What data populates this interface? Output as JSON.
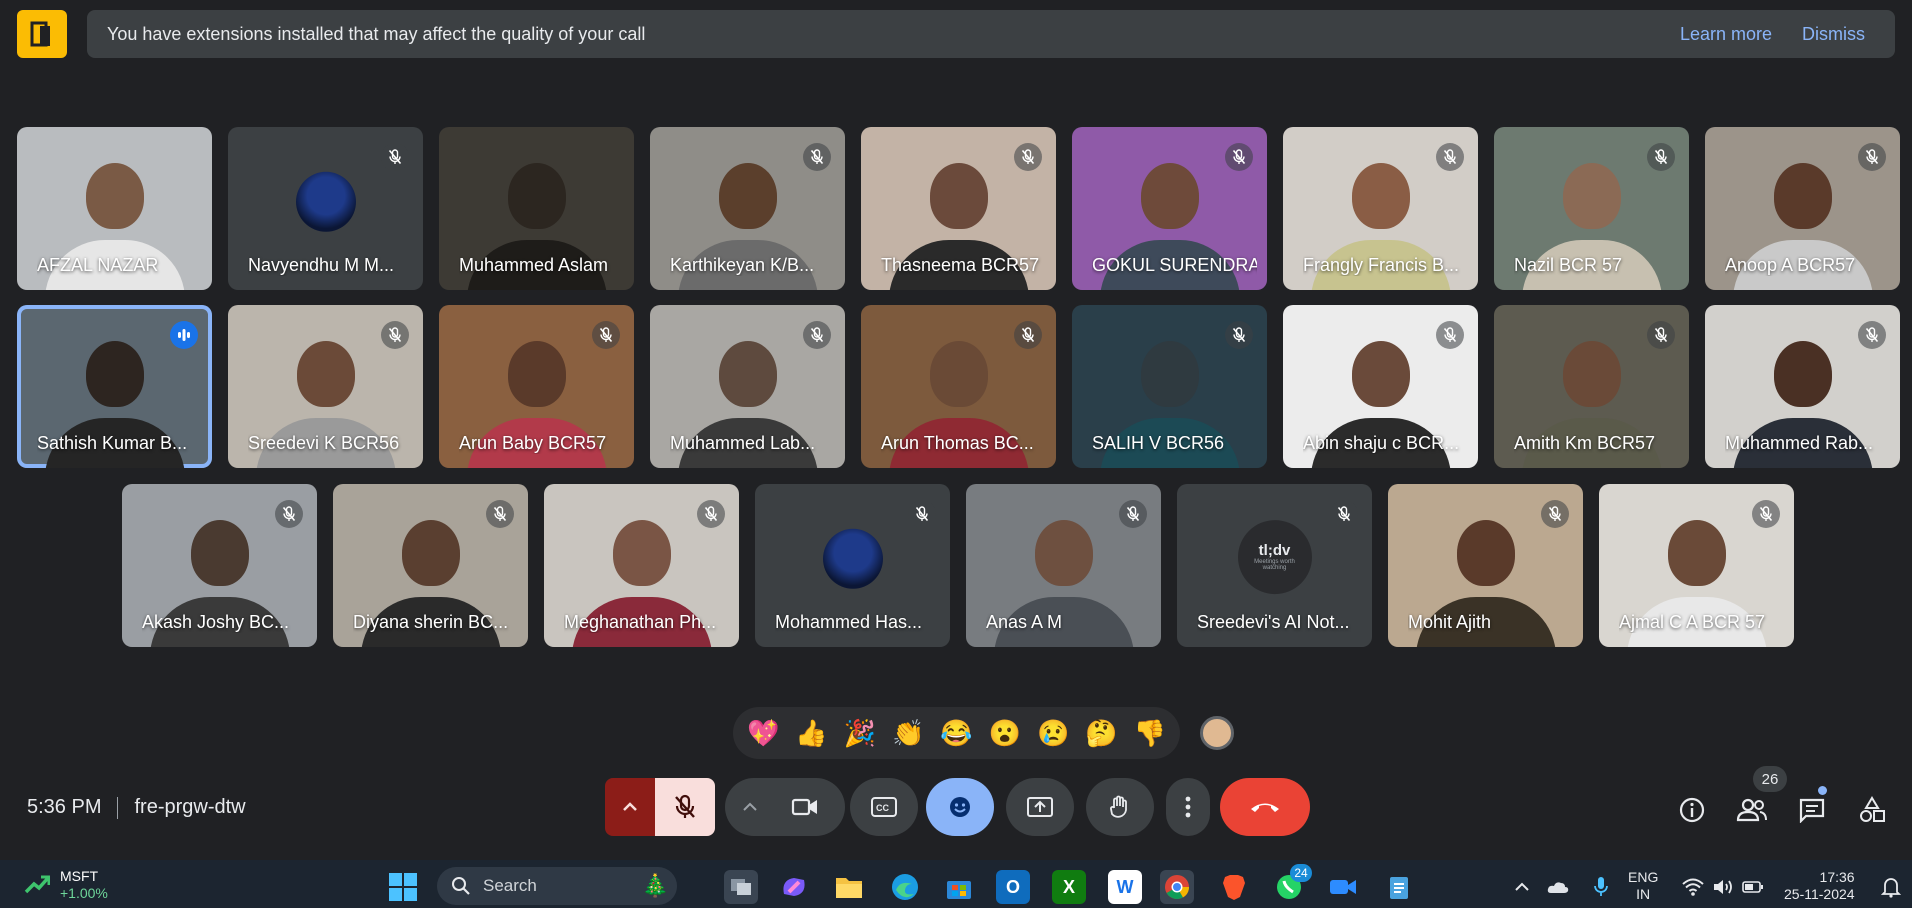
{
  "banner": {
    "message": "You have extensions installed that may affect the quality of your call",
    "learn_more": "Learn more",
    "dismiss": "Dismiss"
  },
  "participants": [
    {
      "name": "AFZAL NAZAR",
      "bg": "#b9bcbf",
      "skin": "#7a5a45",
      "shirt": "#e6e6e6",
      "muted": false
    },
    {
      "name": "Navyendhu M M...",
      "avatar": true,
      "muted": true
    },
    {
      "name": "Muhammed Aslam",
      "bg": "#3d3a34",
      "skin": "#2c2620",
      "shirt": "#1e1c19",
      "muted": false
    },
    {
      "name": "Karthikeyan K/B...",
      "bg": "#8f8d88",
      "skin": "#5b3f2c",
      "shirt": "#6b6b6b",
      "muted": true
    },
    {
      "name": "Thasneema BCR57",
      "bg": "#c3b3a6",
      "skin": "#6b4a3b",
      "shirt": "#2a2a2a",
      "muted": true
    },
    {
      "name": "GOKUL SURENDRAN ...",
      "bg": "#8f5aa8",
      "skin": "#6e4a3a",
      "shirt": "#3e4a5a",
      "muted": true
    },
    {
      "name": "Frangly Francis B...",
      "bg": "#d2cdc7",
      "skin": "#8a5d45",
      "shirt": "#c7c38f",
      "muted": true
    },
    {
      "name": "Nazil BCR 57",
      "bg": "#6d7a70",
      "skin": "#8b6a55",
      "shirt": "#c7c0b0",
      "muted": true
    },
    {
      "name": "Anoop A BCR57",
      "bg": "#9c948a",
      "skin": "#5a3a2a",
      "shirt": "#c9c9c9",
      "muted": true
    },
    {
      "name": "Sathish Kumar B...",
      "bg": "#5b6770",
      "skin": "#2d2520",
      "shirt": "#252525",
      "muted": false,
      "speaking": true,
      "active": true
    },
    {
      "name": "Sreedevi K BCR56",
      "bg": "#bbb5ac",
      "skin": "#6b4a38",
      "shirt": "#9a9a9a",
      "muted": true
    },
    {
      "name": "Arun Baby BCR57",
      "bg": "#8a6040",
      "skin": "#5a3a2a",
      "shirt": "#b23a4a",
      "muted": true
    },
    {
      "name": "Muhammed Lab...",
      "bg": "#a9a7a3",
      "skin": "#5e4a3e",
      "shirt": "#3a3a3a",
      "muted": true
    },
    {
      "name": "Arun Thomas BC...",
      "bg": "#7d5a3d",
      "skin": "#6a4a36",
      "shirt": "#8f2a33",
      "muted": true
    },
    {
      "name": "SALIH V BCR56",
      "bg": "#2a3f4a",
      "skin": "#2f3a40",
      "shirt": "#1c4a55",
      "muted": true
    },
    {
      "name": "Abin shaju c BCR...",
      "bg": "#ececec",
      "skin": "#6a4a3a",
      "shirt": "#2b2b2b",
      "muted": true
    },
    {
      "name": "Amith Km BCR57",
      "bg": "#5d5b50",
      "skin": "#6a4a38",
      "shirt": "#5a5a4a",
      "muted": true
    },
    {
      "name": "Muhammed Rab...",
      "bg": "#d2d0cc",
      "skin": "#4a3024",
      "shirt": "#2a2f38",
      "muted": true
    },
    {
      "name": "Akash Joshy BC...",
      "bg": "#9a9ea3",
      "skin": "#4a3a30",
      "shirt": "#3a3a3a",
      "muted": true
    },
    {
      "name": "Diyana sherin BC...",
      "bg": "#a9a399",
      "skin": "#5a3f30",
      "shirt": "#2a2a2a",
      "muted": true
    },
    {
      "name": "Meghanathan Ph...",
      "bg": "#c9c5bf",
      "skin": "#7a5545",
      "shirt": "#8a2a3a",
      "muted": true
    },
    {
      "name": "Mohammed Has...",
      "avatar": true,
      "muted": true
    },
    {
      "name": "Anas A M",
      "bg": "#787c80",
      "skin": "#6e5040",
      "shirt": "#4a4f55",
      "muted": true
    },
    {
      "name": "Sreedevi's AI Not...",
      "ai": true,
      "ai_title": "tl;dv",
      "ai_sub": "Meetings worth watching",
      "muted": true
    },
    {
      "name": "Mohit Ajith",
      "bg": "#bba890",
      "skin": "#5a3a2a",
      "shirt": "#3a3226",
      "muted": true
    },
    {
      "name": "Ajmal C A BCR 57",
      "bg": "#d9d6d0",
      "skin": "#6a4a38",
      "shirt": "#e8e8e8",
      "muted": true
    }
  ],
  "reactions": [
    "💖",
    "👍",
    "🎉",
    "👏",
    "😂",
    "😮",
    "😢",
    "🤔",
    "👎"
  ],
  "meeting": {
    "time": "5:36 PM",
    "code": "fre-prgw-dtw"
  },
  "people_count": "26",
  "taskbar": {
    "stock_name": "MSFT",
    "stock_change": "+1.00%",
    "search_label": "Search",
    "whatsapp_badge": "24",
    "lang_line1": "ENG",
    "lang_line2": "IN",
    "time": "17:36",
    "date": "25-11-2024"
  },
  "colors": {
    "accent": "#8ab4f8",
    "end_call": "#ea4335",
    "banner_logo": "#fbbc04"
  }
}
